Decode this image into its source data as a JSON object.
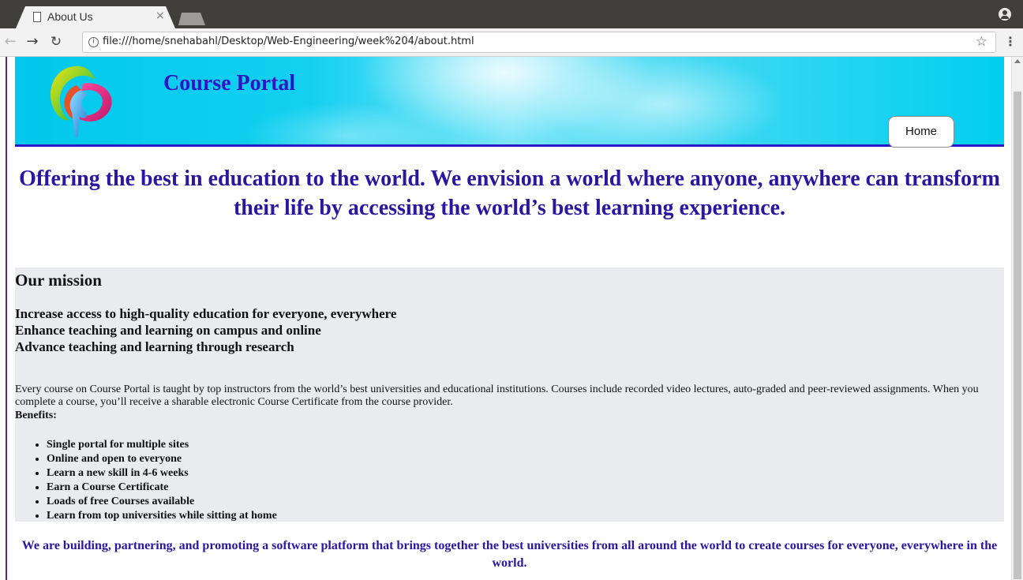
{
  "browser": {
    "tab_title": "About Us",
    "tab_close": "×",
    "url": "file:///home/snehabahl/Desktop/Web-Engineering/week%204/about.html",
    "icons": {
      "back": "back-arrow-icon",
      "forward": "forward-arrow-icon",
      "reload": "reload-icon",
      "info": "info-icon",
      "star": "bookmark-star-icon",
      "menu": "menu-dots-icon",
      "profile": "profile-icon"
    }
  },
  "header": {
    "site_title": "Course Portal",
    "nav": {
      "home_label": "Home"
    },
    "colors": {
      "title": "#2d16c4",
      "banner_start": "#00c8ec",
      "underline": "#2a18c9"
    }
  },
  "tagline": "Offering the best in education to the world. We envision a world where anyone, anywhere can transform their life by accessing the world’s best learning experience.",
  "mission": {
    "heading": "Our mission",
    "goals": [
      "Increase access to high-quality education for everyone, everywhere",
      "Enhance teaching and learning on campus and online",
      "Advance teaching and learning through research"
    ],
    "description": "Every course on Course Portal is taught by top instructors from the world’s best universities and educational institutions. Courses include recorded video lectures, auto-graded and peer-reviewed assignments. When you complete a course, you’ll receive a sharable electronic Course Certificate from the course provider.",
    "benefits_label": "Benefits:",
    "benefits": [
      "Single portal for multiple sites",
      "Online and open to everyone",
      "Learn a new skill in 4-6 weeks",
      "Earn a Course Certificate",
      "Loads of free Courses available",
      "Learn from top universities while sitting at home"
    ]
  },
  "footer": {
    "text": "We are building, partnering, and promoting a software platform that brings together the best universities from all around the world to create courses for everyone, everywhere in the world."
  }
}
